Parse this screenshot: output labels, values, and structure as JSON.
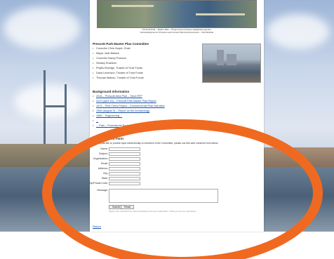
{
  "map": {
    "caption_line1": "Prescott Park – Master Plan – Project Area (inclusive highlighted parcels)",
    "caption_line2": "Acknowledgment of Previous and Current Planning Documents – Visit Website"
  },
  "committee": {
    "heading": "Prescott Park Master Plan Committee",
    "members": [
      "Councilor Chris Dwyer, Chair",
      "Mayor Jack Blalock",
      "Councilor Nancy Pearson",
      "Stefany Shaheen",
      "Phyllis Eldridge, Trustee of Trust Funds",
      "Dana Levenson, Trustee of Trust Funds",
      "Thomas Watson, Trustee of Trust Funds"
    ]
  },
  "background": {
    "heading": "Background Information",
    "links": [
      "2016 – Prescott Area Plan – Town RFP",
      "2013 (April 16) – Prescott Park Master Plan Report",
      "1974 – Prior Trees Project – Environmental Plan Narrative",
      "1966 (August 9) – Report on the Archaeology",
      "1966 – Engineering ...",
      "... ",
      "... Park – Promotional Booklet"
    ]
  },
  "form": {
    "heading": "Web Comment Form",
    "intro": "If you would like to provide input electronically to members of the Committee, please use this web comment form below.",
    "fields": [
      "Name:",
      "Subject:",
      "Organization:",
      "Email:",
      "Address:",
      "City:",
      "State:",
      "Zip/Postal Code:"
    ],
    "message_label": "Message:",
    "submit_label": "Submit",
    "reset_label": "Reset",
    "note": "Please note submitted text will be forwarded to the list of subscribers. Thank you for your submission."
  },
  "footer": {
    "return_label": "Return"
  },
  "colors": {
    "annotation_ring": "#ef6a20",
    "link": "#1a4fa0"
  }
}
